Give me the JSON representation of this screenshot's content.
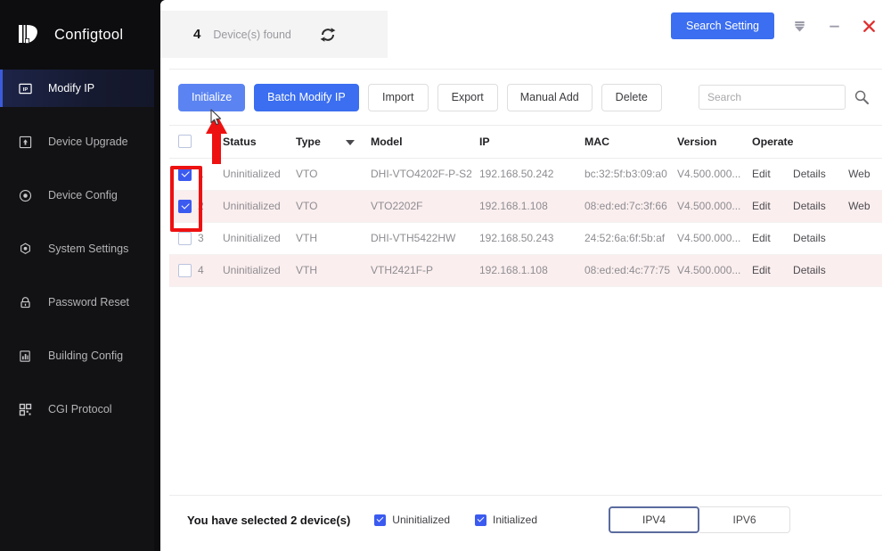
{
  "app": {
    "brand_name": "Configtool",
    "logo_icon": "dahua-logo-icon"
  },
  "sidebar": {
    "items": [
      {
        "label": "Modify IP",
        "icon": "ip-box-icon",
        "active": true
      },
      {
        "label": "Device Upgrade",
        "icon": "upload-box-icon",
        "active": false
      },
      {
        "label": "Device Config",
        "icon": "target-circle-icon",
        "active": false
      },
      {
        "label": "System Settings",
        "icon": "gear-icon",
        "active": false
      },
      {
        "label": "Password Reset",
        "icon": "lock-icon",
        "active": false
      },
      {
        "label": "Building Config",
        "icon": "bar-chart-icon",
        "active": false
      },
      {
        "label": "CGI Protocol",
        "icon": "qr-code-icon",
        "active": false
      }
    ]
  },
  "topbar": {
    "device_count": "4",
    "device_found_label": "Device(s) found",
    "refresh_icon": "refresh-icon",
    "search_setting_label": "Search Setting",
    "filter_icon": "filter-icon",
    "minimize_icon": "minimize-icon",
    "close_icon": "close-icon"
  },
  "toolbar": {
    "initialize_label": "Initialize",
    "batch_modify_ip_label": "Batch Modify IP",
    "import_label": "Import",
    "export_label": "Export",
    "manual_add_label": "Manual Add",
    "delete_label": "Delete",
    "search_placeholder": "Search",
    "search_value": "",
    "search_icon": "search-icon"
  },
  "table": {
    "headers": {
      "no": "",
      "status": "Status",
      "type": "Type",
      "model": "Model",
      "ip": "IP",
      "mac": "MAC",
      "version": "Version",
      "operate": "Operate"
    },
    "header_checkbox_checked": false,
    "sort_icon": "sort-descending-icon",
    "rows": [
      {
        "checked": true,
        "no": "1",
        "status": "Uninitialized",
        "type": "VTO",
        "model": "DHI-VTO4202F-P-S2",
        "ip": "192.168.50.242",
        "mac": "bc:32:5f:b3:09:a0",
        "version": "V4.500.000...",
        "ops": [
          "Edit",
          "Details",
          "Web"
        ]
      },
      {
        "checked": true,
        "no": "2",
        "status": "Uninitialized",
        "type": "VTO",
        "model": "VTO2202F",
        "ip": "192.168.1.108",
        "mac": "08:ed:ed:7c:3f:66",
        "version": "V4.500.000...",
        "ops": [
          "Edit",
          "Details",
          "Web"
        ]
      },
      {
        "checked": false,
        "no": "3",
        "status": "Uninitialized",
        "type": "VTH",
        "model": "DHI-VTH5422HW",
        "ip": "192.168.50.243",
        "mac": "24:52:6a:6f:5b:af",
        "version": "V4.500.000...",
        "ops": [
          "Edit",
          "Details"
        ]
      },
      {
        "checked": false,
        "no": "4",
        "status": "Uninitialized",
        "type": "VTH",
        "model": "VTH2421F-P",
        "ip": "192.168.1.108",
        "mac": "08:ed:ed:4c:77:75",
        "version": "V4.500.000...",
        "ops": [
          "Edit",
          "Details"
        ]
      }
    ]
  },
  "footer": {
    "selected_text": "You have selected 2  device(s)",
    "uninitialized_label": "Uninitialized",
    "uninitialized_checked": true,
    "initialized_label": "Initialized",
    "initialized_checked": true,
    "ipv4_label": "IPV4",
    "ipv6_label": "IPV6",
    "ip_version_selected": "IPV4"
  },
  "annotations": {
    "highlight_color": "#ee1111",
    "arrow_color": "#ee1111"
  },
  "colors": {
    "accent_blue": "#3b6ef0",
    "checkbox_blue": "#3b5bf0",
    "sidebar_bg": "#121214",
    "row_alt_bg": "#fbeeee"
  }
}
